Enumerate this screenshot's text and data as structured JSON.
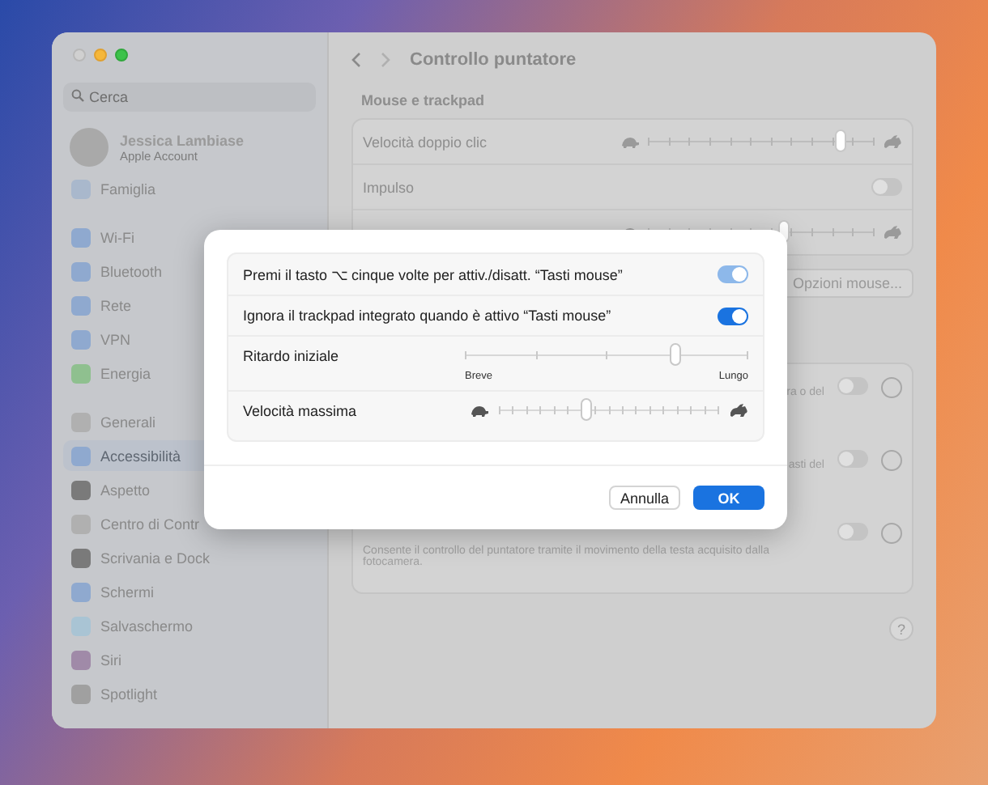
{
  "window": {
    "title": "Controllo puntatore"
  },
  "sidebar": {
    "search": {
      "placeholder": "Cerca"
    },
    "account": {
      "name": "Jessica Lambiase",
      "subtitle": "Apple Account"
    },
    "groups": [
      [
        {
          "label": "Famiglia",
          "selected": false,
          "color": "#a9b8cc"
        }
      ],
      [
        {
          "label": "Wi-Fi",
          "selected": false,
          "color": "#8fa9cf"
        },
        {
          "label": "Bluetooth",
          "selected": false,
          "color": "#8fa9cf"
        },
        {
          "label": "Rete",
          "selected": false,
          "color": "#8fa9cf"
        },
        {
          "label": "VPN",
          "selected": false,
          "color": "#8fa9cf"
        },
        {
          "label": "Energia",
          "selected": false,
          "color": "#8fc08f"
        }
      ],
      [
        {
          "label": "Generali",
          "selected": false,
          "color": "#b0b0b0"
        },
        {
          "label": "Accessibilità",
          "selected": true,
          "color": "#8fa9cf"
        },
        {
          "label": "Aspetto",
          "selected": false,
          "color": "#7a7a7a"
        },
        {
          "label": "Centro di Contr",
          "selected": false,
          "color": "#b0b0b0"
        },
        {
          "label": "Scrivania e Dock",
          "selected": false,
          "color": "#7a7a7a"
        },
        {
          "label": "Schermi",
          "selected": false,
          "color": "#8fa9cf"
        },
        {
          "label": "Salvaschermo",
          "selected": false,
          "color": "#a9c4d4"
        },
        {
          "label": "Siri",
          "selected": false,
          "color": "#a08aa8"
        },
        {
          "label": "Spotlight",
          "selected": false,
          "color": "#a0a0a0"
        }
      ]
    ]
  },
  "main": {
    "section_title": "Mouse e trackpad",
    "group": [
      {
        "kind": "slider",
        "label": "Velocità doppio clic",
        "level": 0.85
      },
      {
        "kind": "toggle",
        "label": "Impulso",
        "on": false
      },
      {
        "kind": "slider",
        "level": 0.6
      }
    ],
    "options_button": "Opzioni mouse...",
    "lower_group": [
      {
        "description": "ra o del",
        "on": false
      },
      {
        "description": "asti del",
        "on": false
      },
      {
        "description": "Consente il controllo del puntatore tramite il movimento della testa acquisito dalla fotocamera.",
        "on": false
      }
    ],
    "help_button": "?"
  },
  "dialog": {
    "rows": [
      {
        "kind": "toggle",
        "label": "Premi il tasto ⌥ cinque volte per attiv./disatt. “Tasti mouse”",
        "on": true,
        "disabled": true
      },
      {
        "kind": "toggle",
        "label": "Ignora il trackpad integrato quando è attivo “Tasti mouse”",
        "on": true,
        "disabled": false
      },
      {
        "kind": "slider",
        "label": "Ritardo iniziale",
        "level": 0.74,
        "min_label": "Breve",
        "max_label": "Lungo"
      },
      {
        "kind": "slider",
        "label": "Velocità massima",
        "level": 0.4
      }
    ],
    "buttons": [
      {
        "label": "Annulla",
        "primary": false
      },
      {
        "label": "OK",
        "primary": true
      }
    ]
  }
}
